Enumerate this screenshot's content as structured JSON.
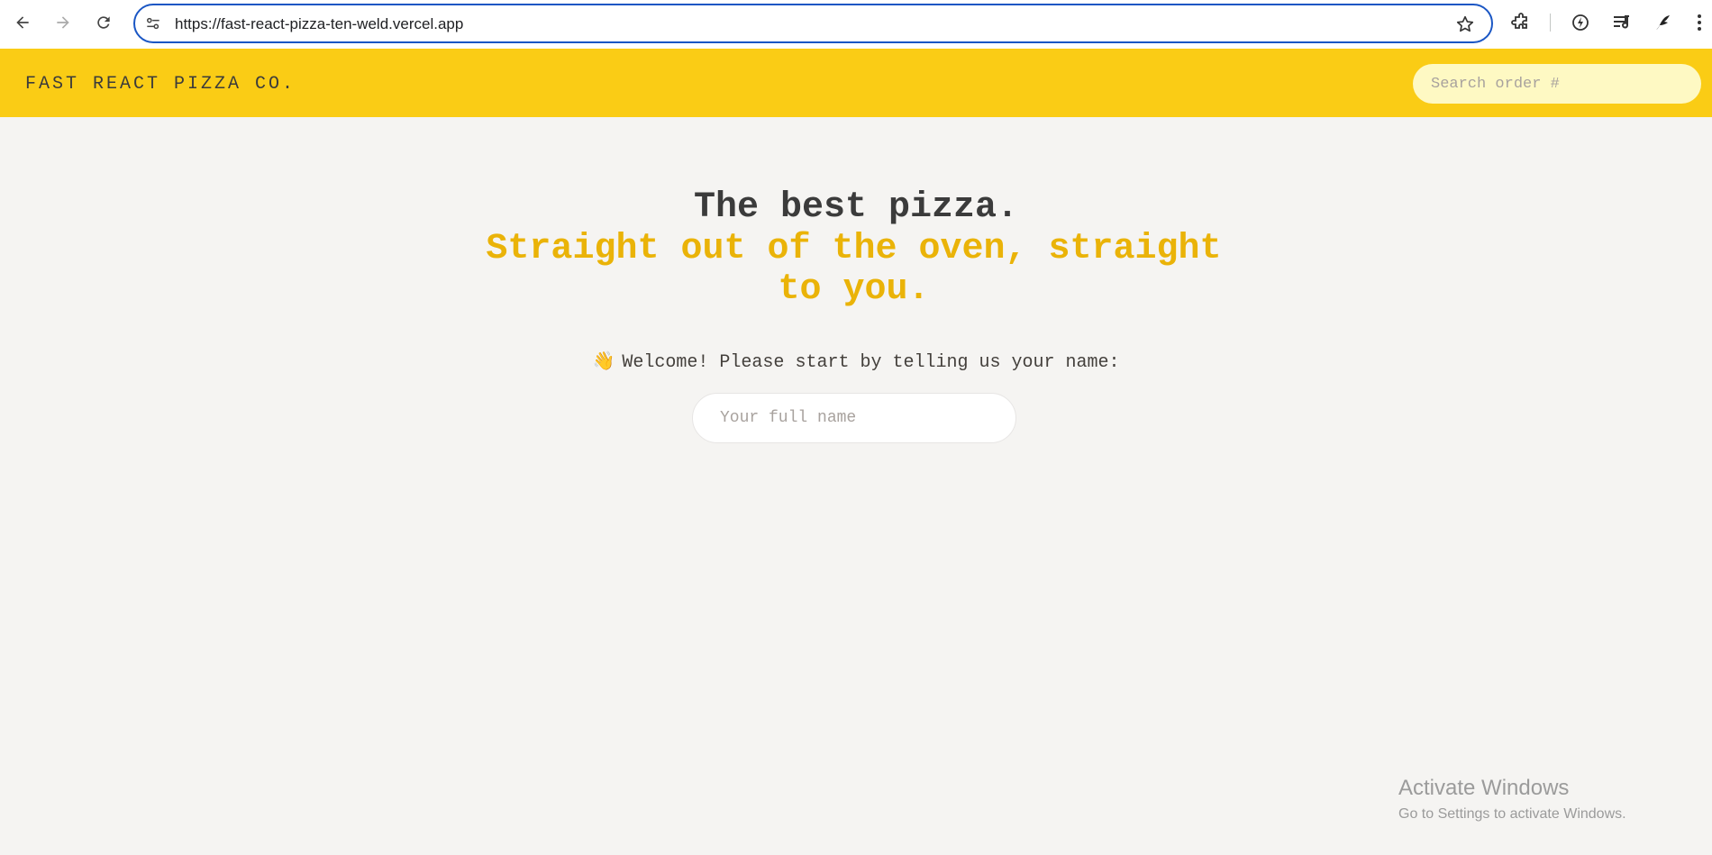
{
  "browser": {
    "url": "https://fast-react-pizza-ten-weld.vercel.app"
  },
  "header": {
    "logo": "FAST REACT PIZZA CO.",
    "search_placeholder": "Search order #"
  },
  "hero": {
    "headline": "The best pizza.",
    "tagline": "Straight out of the oven, straight to you."
  },
  "welcome": {
    "emoji": "👋",
    "text": "Welcome! Please start by telling us your name:",
    "name_placeholder": "Your full name",
    "name_value": ""
  },
  "watermark": {
    "title": "Activate Windows",
    "subtitle": "Go to Settings to activate Windows."
  },
  "colors": {
    "header_bg": "#facc15",
    "accent": "#eab308",
    "page_bg": "#f5f4f2",
    "address_border": "#1a56c4"
  }
}
